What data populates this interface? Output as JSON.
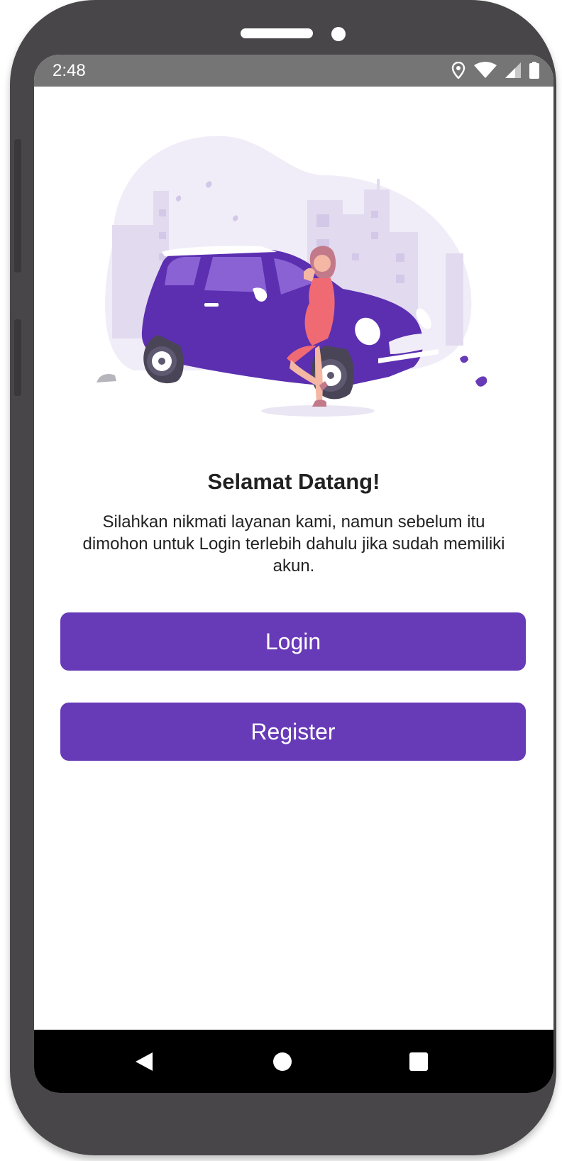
{
  "status_bar": {
    "time": "2:48",
    "icons": [
      "location-icon",
      "wifi-icon",
      "cell-signal-icon",
      "battery-icon"
    ]
  },
  "welcome": {
    "title": "Selamat Datang!",
    "subtitle": "Silahkan nikmati layanan kami, namun sebelum itu dimohon untuk Login terlebih dahulu jika sudah memiliki akun."
  },
  "actions": {
    "login_label": "Login",
    "register_label": "Register"
  },
  "navigation": {
    "icons": [
      "back-icon",
      "home-icon",
      "recents-icon"
    ]
  },
  "colors": {
    "primary": "#673ab7",
    "status_bar": "#767576",
    "phone_frame": "#484648",
    "car": "#5b2fb0",
    "dress": "#f06a74"
  }
}
